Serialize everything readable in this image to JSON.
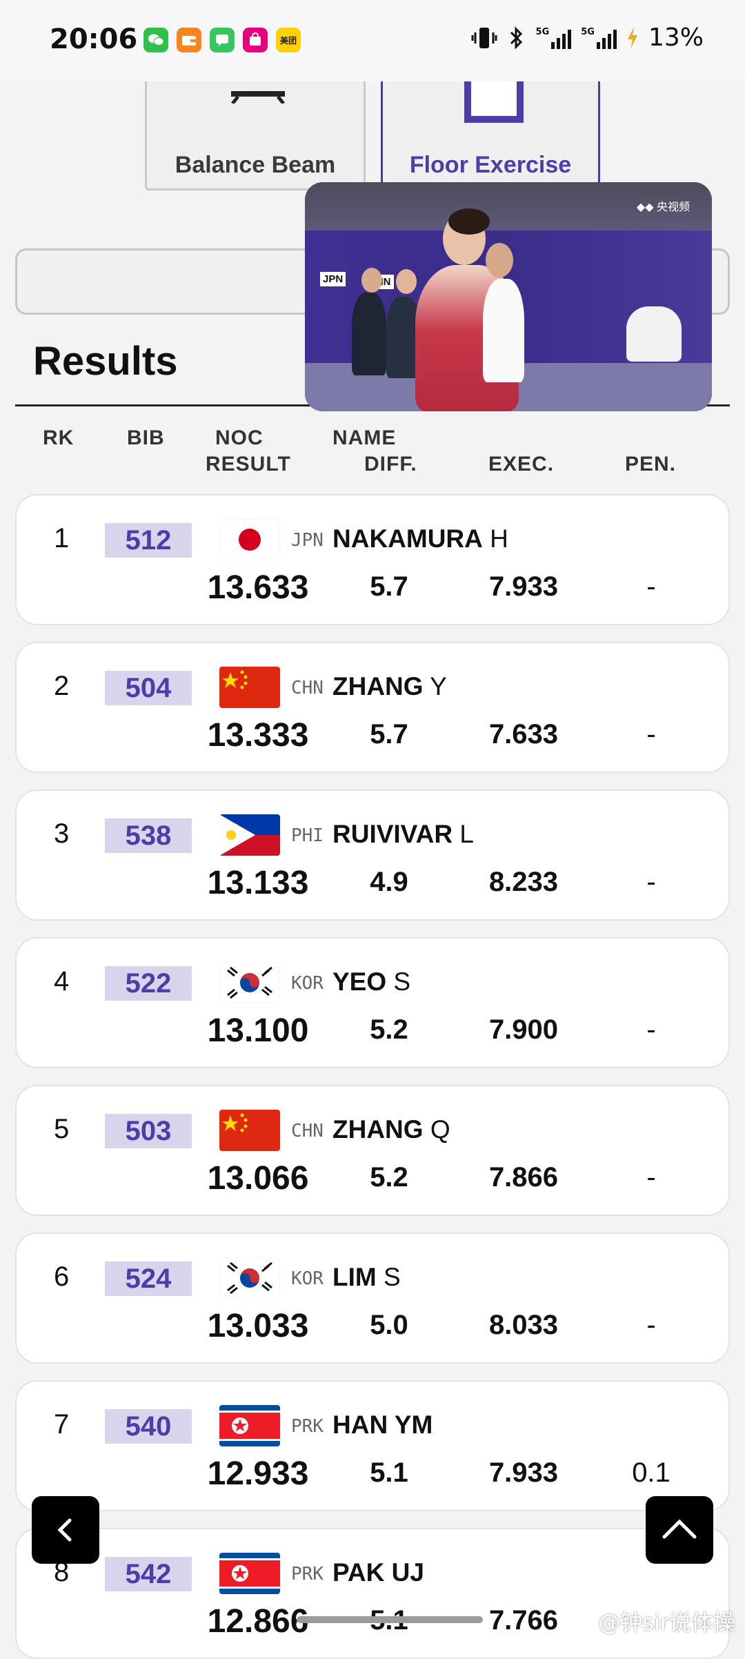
{
  "status_bar": {
    "time": "20:06",
    "battery": "13%",
    "apps": [
      {
        "icon": "wechat-icon",
        "color": "#2fbf4a"
      },
      {
        "icon": "wallet-icon",
        "color": "#f7841e"
      },
      {
        "icon": "messages-icon",
        "color": "#34c759"
      },
      {
        "icon": "shopping-app-icon",
        "color": "#e6007e"
      },
      {
        "icon": "meituan-icon",
        "color": "#ffd100",
        "text": "美团"
      }
    ]
  },
  "apparatus": {
    "balance_beam": "Balance Beam",
    "floor_exercise": "Floor Exercise"
  },
  "video": {
    "channel": "央视频",
    "signs": [
      "JPN",
      "CHN"
    ]
  },
  "results": {
    "title": "Results",
    "headers": {
      "rk": "RK",
      "bib": "BIB",
      "noc": "NOC",
      "name": "NAME",
      "result": "RESULT",
      "diff": "DIFF.",
      "exec": "EXEC.",
      "pen": "PEN."
    },
    "rows": [
      {
        "rk": "1",
        "bib": "512",
        "noc": "JPN",
        "surname": "NAKAMURA",
        "initial": "H",
        "result": "13.633",
        "diff": "5.7",
        "exec": "7.933",
        "pen": "-"
      },
      {
        "rk": "2",
        "bib": "504",
        "noc": "CHN",
        "surname": "ZHANG",
        "initial": "Y",
        "result": "13.333",
        "diff": "5.7",
        "exec": "7.633",
        "pen": "-"
      },
      {
        "rk": "3",
        "bib": "538",
        "noc": "PHI",
        "surname": "RUIVIVAR",
        "initial": "L",
        "result": "13.133",
        "diff": "4.9",
        "exec": "8.233",
        "pen": "-"
      },
      {
        "rk": "4",
        "bib": "522",
        "noc": "KOR",
        "surname": "YEO",
        "initial": "S",
        "result": "13.100",
        "diff": "5.2",
        "exec": "7.900",
        "pen": "-"
      },
      {
        "rk": "5",
        "bib": "503",
        "noc": "CHN",
        "surname": "ZHANG",
        "initial": "Q",
        "result": "13.066",
        "diff": "5.2",
        "exec": "7.866",
        "pen": "-"
      },
      {
        "rk": "6",
        "bib": "524",
        "noc": "KOR",
        "surname": "LIM",
        "initial": "S",
        "result": "13.033",
        "diff": "5.0",
        "exec": "8.033",
        "pen": "-"
      },
      {
        "rk": "7",
        "bib": "540",
        "noc": "PRK",
        "surname": "HAN YM",
        "initial": "",
        "result": "12.933",
        "diff": "5.1",
        "exec": "7.933",
        "pen": "0.1"
      },
      {
        "rk": "8",
        "bib": "542",
        "noc": "PRK",
        "surname": "PAK UJ",
        "initial": "",
        "result": "12.866",
        "diff": "5.1",
        "exec": "7.766",
        "pen": ""
      }
    ]
  },
  "watermark": "@钟sir说体操",
  "accent_color": "#4a3ea8"
}
